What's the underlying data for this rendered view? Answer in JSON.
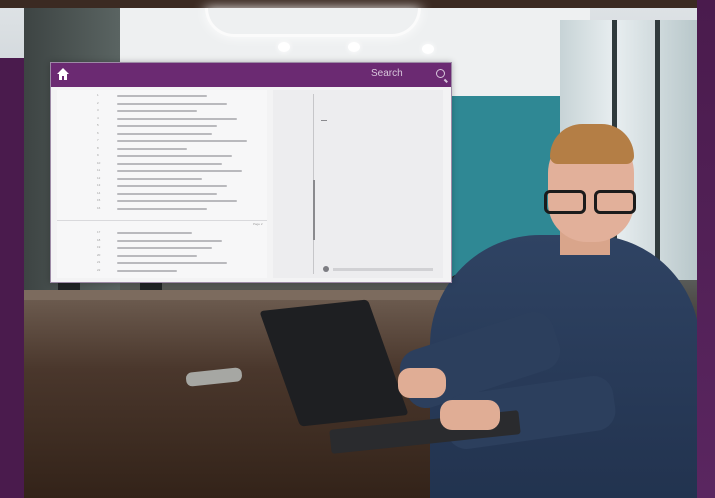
{
  "app": {
    "search_placeholder": "Search",
    "icons": {
      "home": "home-icon",
      "search": "search-icon"
    },
    "colors": {
      "header": "#6b2a72",
      "frame": "#4a1b4d"
    }
  },
  "document": {
    "line_numbers": [
      "1",
      "2",
      "3",
      "4",
      "5",
      "6",
      "7",
      "8",
      "9",
      "10",
      "11",
      "12",
      "13",
      "14",
      "15",
      "16",
      "17",
      "18",
      "19",
      "20",
      "21",
      "22"
    ],
    "page_marker": "Page 2"
  }
}
